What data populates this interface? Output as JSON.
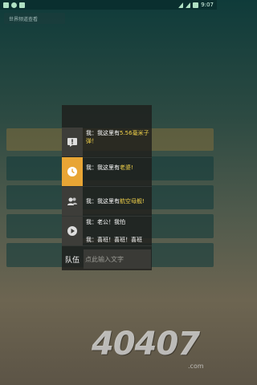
{
  "status_bar": {
    "time": "9:07"
  },
  "top_button": {
    "label": "世界频道查看"
  },
  "chat": {
    "items": [
      {
        "icon": "alert-icon",
        "prefix": "我：我这里有",
        "highlight": "5.56毫米子弹！",
        "suffix": "",
        "active": false
      },
      {
        "icon": "clock-icon",
        "prefix": "我：我这里有",
        "highlight": "老婆!",
        "suffix": "",
        "active": true
      },
      {
        "icon": "people-icon",
        "prefix": "我：我这里有",
        "highlight": "航空母舰!",
        "suffix": "",
        "active": false
      },
      {
        "icon": "play-icon",
        "prefix": "我：老公！我怕",
        "highlight": "",
        "suffix": "",
        "active": false
      },
      {
        "icon": "",
        "prefix": "我：喜班！喜班！喜班",
        "highlight": "",
        "suffix": "",
        "active": false
      }
    ],
    "team_label": "队伍",
    "input_placeholder": "点此输入文字"
  },
  "watermark": {
    "text": "40407",
    "sub": ".com"
  },
  "colors": {
    "active_icon_bg": "#e8a535",
    "highlight": "#f2d24a"
  }
}
